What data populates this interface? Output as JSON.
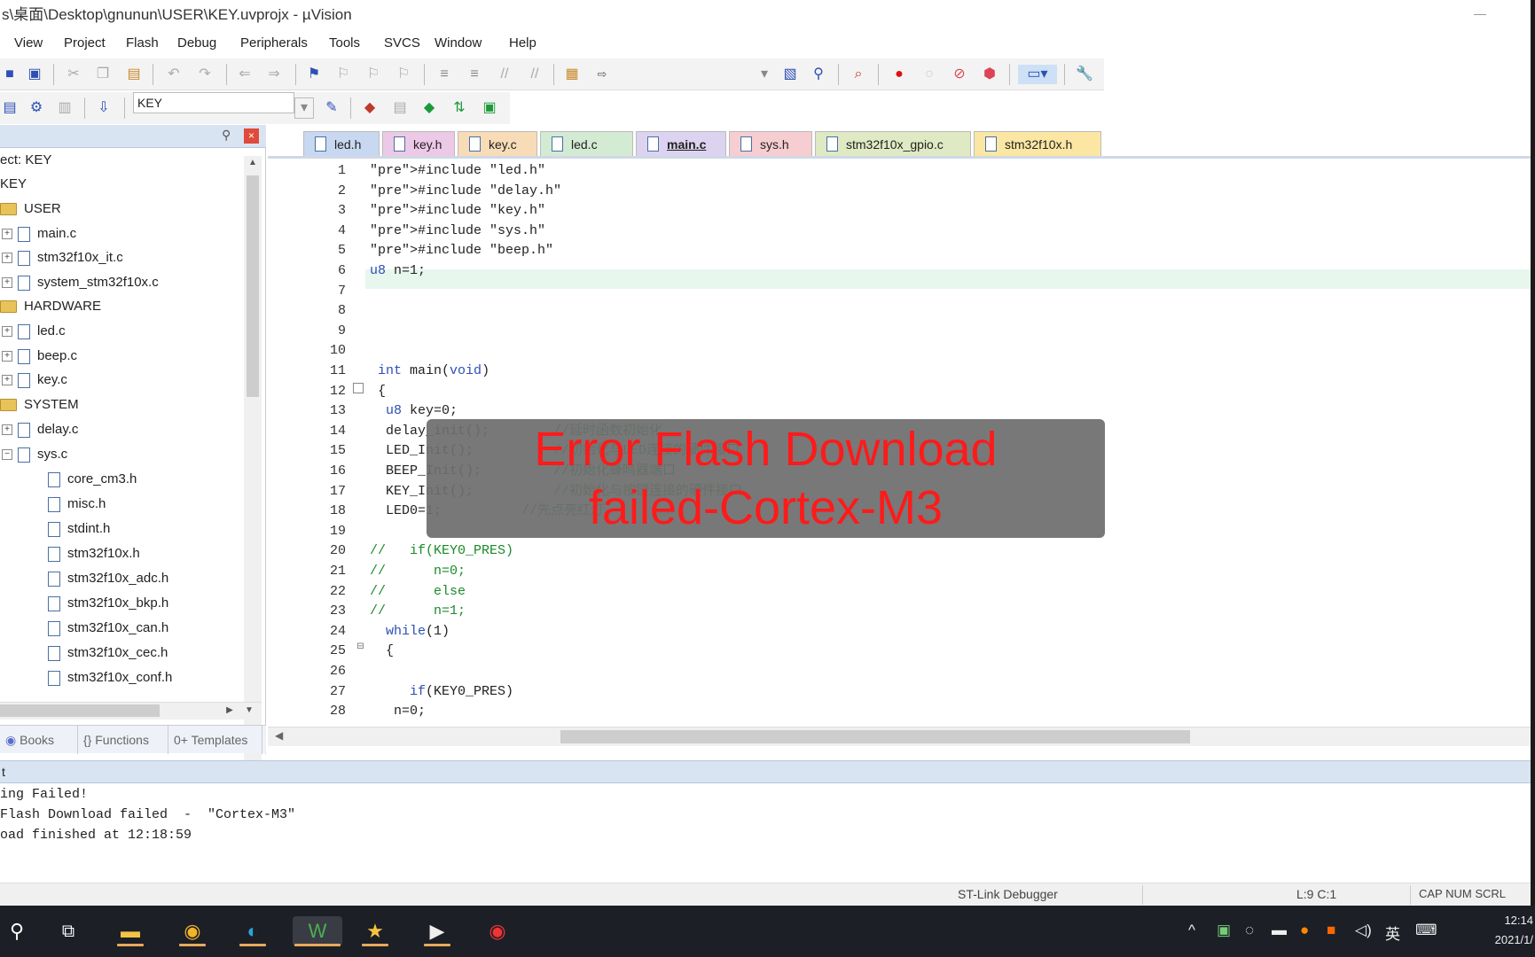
{
  "window": {
    "title": "s\\桌面\\Desktop\\gnunun\\USER\\KEY.uvprojx - µVision"
  },
  "menu": [
    "View",
    "Project",
    "Flash",
    "Debug",
    "Peripherals",
    "Tools",
    "SVCS",
    "Window",
    "Help"
  ],
  "toolbar": {
    "target_combo": "KEY"
  },
  "project_panel": {
    "tree": [
      {
        "label": "ect: KEY",
        "kind": "root"
      },
      {
        "label": "KEY",
        "kind": "target"
      },
      {
        "label": "USER",
        "kind": "group"
      },
      {
        "label": "main.c",
        "kind": "file"
      },
      {
        "label": "stm32f10x_it.c",
        "kind": "file"
      },
      {
        "label": "system_stm32f10x.c",
        "kind": "file"
      },
      {
        "label": "HARDWARE",
        "kind": "group"
      },
      {
        "label": "led.c",
        "kind": "file"
      },
      {
        "label": "beep.c",
        "kind": "file"
      },
      {
        "label": "key.c",
        "kind": "file"
      },
      {
        "label": "SYSTEM",
        "kind": "group"
      },
      {
        "label": "delay.c",
        "kind": "file"
      },
      {
        "label": "sys.c",
        "kind": "file"
      },
      {
        "label": "core_cm3.h",
        "kind": "header"
      },
      {
        "label": "misc.h",
        "kind": "header"
      },
      {
        "label": "stdint.h",
        "kind": "header"
      },
      {
        "label": "stm32f10x.h",
        "kind": "header"
      },
      {
        "label": "stm32f10x_adc.h",
        "kind": "header"
      },
      {
        "label": "stm32f10x_bkp.h",
        "kind": "header"
      },
      {
        "label": "stm32f10x_can.h",
        "kind": "header"
      },
      {
        "label": "stm32f10x_cec.h",
        "kind": "header"
      },
      {
        "label": "stm32f10x_conf.h",
        "kind": "header"
      }
    ],
    "tabs": [
      "Books",
      "{} Functions",
      "0+ Templates"
    ]
  },
  "editor": {
    "tabs": [
      {
        "label": "led.h",
        "color": "#c8d8f0"
      },
      {
        "label": "key.h",
        "color": "#ecc9e6"
      },
      {
        "label": "key.c",
        "color": "#f7dcb7"
      },
      {
        "label": "led.c",
        "color": "#d3ead3"
      },
      {
        "label": "main.c",
        "color": "#dcd3f0",
        "active": true
      },
      {
        "label": "sys.h",
        "color": "#f6cdd0"
      },
      {
        "label": "stm32f10x_gpio.c",
        "color": "#dfe9c3"
      },
      {
        "label": "stm32f10x.h",
        "color": "#fbe7a3"
      }
    ],
    "lines": [
      {
        "n": "1",
        "text": "#include \"led.h\""
      },
      {
        "n": "2",
        "text": "#include \"delay.h\""
      },
      {
        "n": "3",
        "text": "#include \"key.h\""
      },
      {
        "n": "4",
        "text": "#include \"sys.h\""
      },
      {
        "n": "5",
        "text": "#include \"beep.h\""
      },
      {
        "n": "6",
        "text": "u8 n=1;"
      },
      {
        "n": "7",
        "text": ""
      },
      {
        "n": "8",
        "text": ""
      },
      {
        "n": "9",
        "text": ""
      },
      {
        "n": "10",
        "text": ""
      },
      {
        "n": "11",
        "text": " int main(void)"
      },
      {
        "n": "12",
        "text": " {"
      },
      {
        "n": "13",
        "text": "  u8 key=0;"
      },
      {
        "n": "14",
        "text": "  delay_init();        //延时函数初始化"
      },
      {
        "n": "15",
        "text": "  LED_Init();          //初始化与LED连接的硬件接口"
      },
      {
        "n": "16",
        "text": "  BEEP_Init();         //初始化蜂鸣器端口"
      },
      {
        "n": "17",
        "text": "  KEY_Init();          //初始化与按键连接的硬件接口"
      },
      {
        "n": "18",
        "text": "  LED0=1;          //先点亮红灯"
      },
      {
        "n": "19",
        "text": ""
      },
      {
        "n": "20",
        "text": "//   if(KEY0_PRES)"
      },
      {
        "n": "21",
        "text": "//      n=0;"
      },
      {
        "n": "22",
        "text": "//      else"
      },
      {
        "n": "23",
        "text": "//      n=1;"
      },
      {
        "n": "24",
        "text": "  while(1)"
      },
      {
        "n": "25",
        "text": "  {"
      },
      {
        "n": "26",
        "text": ""
      },
      {
        "n": "27",
        "text": "     if(KEY0_PRES)"
      },
      {
        "n": "28",
        "text": "   n=0;"
      }
    ]
  },
  "build_output": {
    "title": "t",
    "lines": [
      "ing Failed!",
      "Flash Download failed  -  \"Cortex-M3\"",
      "oad finished at 12:18:59"
    ]
  },
  "status": {
    "debugger": "ST-Link Debugger",
    "position": "L:9 C:1",
    "keys": "CAP  NUM  SCRL"
  },
  "toast": {
    "message": "Error Flash Download failed-Cortex-M3",
    "color": "#ff1a1a"
  },
  "taskbar": {
    "apps": [
      "search",
      "task-view",
      "file-explorer",
      "chrome",
      "edge",
      "keil-uvision",
      "favorites",
      "media-player",
      "screen-recorder"
    ],
    "tray": {
      "ime": "英",
      "time": "12:14",
      "date": "2021/1/"
    }
  }
}
